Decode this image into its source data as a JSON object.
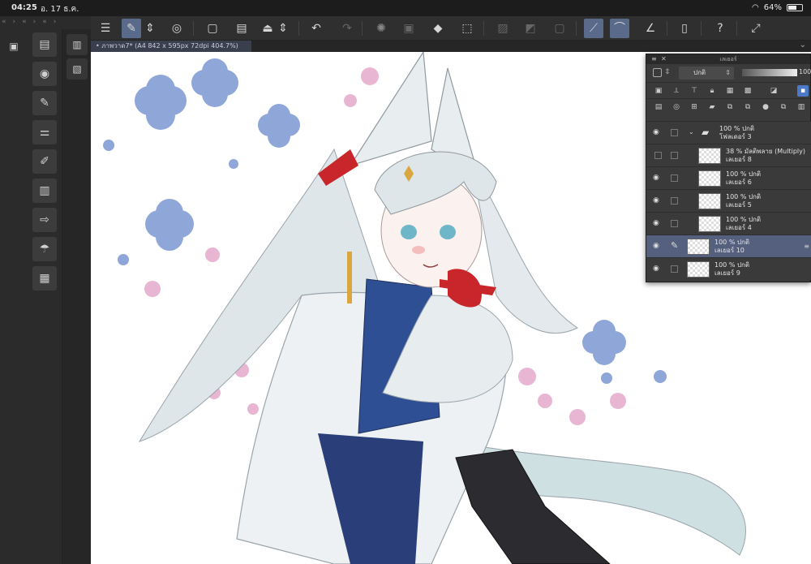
{
  "status": {
    "time": "04:25",
    "date": "อ. 17 ธ.ค.",
    "battery_text": "64%",
    "battery_level": 0.64
  },
  "document_tab": {
    "label": "ภาพวาด7* (A4 842 x 595px 72dpi 404.7%)"
  },
  "layer_panel": {
    "title": "เลเยอร์",
    "blend_mode": "ปกติ",
    "opacity_value": "100",
    "layers": [
      {
        "opacity": "100 %",
        "mode": "ปกติ",
        "name": "โฟลเดอร์ 3",
        "kind": "folder",
        "indent": 0,
        "visible": true,
        "selected": false
      },
      {
        "opacity": "38 %",
        "mode": "มัลติพลาย (Multiply)",
        "name": "เลเยอร์ 8",
        "kind": "layer",
        "indent": 1,
        "visible": false,
        "selected": false
      },
      {
        "opacity": "100 %",
        "mode": "ปกติ",
        "name": "เลเยอร์ 6",
        "kind": "layer",
        "indent": 1,
        "visible": true,
        "selected": false
      },
      {
        "opacity": "100 %",
        "mode": "ปกติ",
        "name": "เลเยอร์ 5",
        "kind": "layer",
        "indent": 1,
        "visible": true,
        "selected": false
      },
      {
        "opacity": "100 %",
        "mode": "ปกติ",
        "name": "เลเยอร์ 4",
        "kind": "layer",
        "indent": 1,
        "visible": true,
        "selected": false
      },
      {
        "opacity": "100 %",
        "mode": "ปกติ",
        "name": "เลเยอร์ 10",
        "kind": "layer",
        "indent": 0,
        "visible": true,
        "selected": true
      },
      {
        "opacity": "100 %",
        "mode": "ปกติ",
        "name": "เลเยอร์ 9",
        "kind": "layer",
        "indent": 0,
        "visible": true,
        "selected": false
      }
    ]
  },
  "toolbar_icons": [
    "menu-icon",
    "select-tool-icon",
    "stepper-icon",
    "target-icon",
    "new-page-icon",
    "save-icon",
    "export-icon",
    "undo-icon",
    "redo-icon",
    "loading-icon",
    "transform-icon",
    "fill-icon",
    "crop-icon",
    "no-selection-icon",
    "invert-icon",
    "frame-icon",
    "pen-ruler-icon",
    "snap-icon",
    "pen-angle-icon",
    "device-icon",
    "help-icon",
    "fullscreen-icon"
  ],
  "left_tool_icons": [
    "navigator-icon",
    "sub-tool-icon",
    "brush-icon",
    "tool-property-icon",
    "brush-size-icon",
    "color-wheel-icon",
    "color-set-icon",
    "color-history-icon",
    "material-icon"
  ],
  "colors": {
    "accent": "#5a6a8a",
    "selected_layer": "#55607e",
    "flower_blue": "#8fa6d8",
    "flower_pink": "#e8b6d2"
  }
}
